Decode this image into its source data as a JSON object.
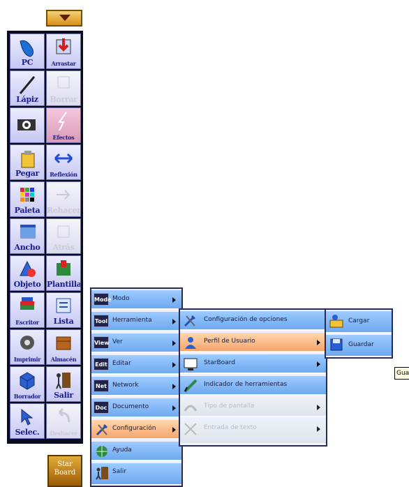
{
  "toolbar": {
    "tools": [
      {
        "label": "PC",
        "icon": "mouse-icon"
      },
      {
        "label": "Arrastar",
        "icon": "drag-icon"
      },
      {
        "label": "Lápiz",
        "icon": "pencil-icon"
      },
      {
        "label": "Borrar",
        "icon": "eraser-icon"
      },
      {
        "label": "",
        "icon": "camera-icon"
      },
      {
        "label": "Efectos",
        "icon": "effects-icon"
      },
      {
        "label": "Pegar",
        "icon": "paste-icon"
      },
      {
        "label": "Reflexión",
        "icon": "reflect-icon"
      },
      {
        "label": "Paleta",
        "icon": "palette-icon"
      },
      {
        "label": "Rehacer",
        "icon": "redo-icon"
      },
      {
        "label": "Ancho",
        "icon": "width-icon"
      },
      {
        "label": "Atrás",
        "icon": "back-icon"
      },
      {
        "label": "Objeto",
        "icon": "shapes-icon"
      },
      {
        "label": "Plantilla",
        "icon": "template-icon"
      },
      {
        "label": "Escritor",
        "icon": "writer-icon"
      },
      {
        "label": "Lista",
        "icon": "list-icon"
      },
      {
        "label": "Imprimir",
        "icon": "printer-icon"
      },
      {
        "label": "Almacén",
        "icon": "storage-icon"
      },
      {
        "label": "Borrador",
        "icon": "cube-eraser-icon"
      },
      {
        "label": "Salir",
        "icon": "exit-icon"
      },
      {
        "label": "Selec.",
        "icon": "select-arrow-icon"
      },
      {
        "label": "Deshacer",
        "icon": "undo-icon"
      }
    ],
    "start_label_line1": "Star",
    "start_label_line2": "Board"
  },
  "menu_main": {
    "items": [
      {
        "badge": "Mode",
        "label": "Modo"
      },
      {
        "badge": "Tool",
        "label": "Herramienta"
      },
      {
        "badge": "View",
        "label": "Ver"
      },
      {
        "badge": "Edit",
        "label": "Editar"
      },
      {
        "badge": "Net",
        "label": "Network"
      },
      {
        "badge": "Doc",
        "label": "Documento"
      },
      {
        "badge": "",
        "label": "Configuración"
      },
      {
        "badge": "",
        "label": "Ayuda"
      },
      {
        "badge": "",
        "label": "Salir"
      }
    ]
  },
  "menu_config": {
    "items": [
      {
        "label": "Configuración de opciones"
      },
      {
        "label": "Perfil de Usuario"
      },
      {
        "label": "StarBoard"
      },
      {
        "label": "Indicador de herramientas"
      },
      {
        "label": "Tipo de pantalla"
      },
      {
        "label": "Entrada de texto"
      }
    ]
  },
  "menu_profile": {
    "items": [
      {
        "label": "Cargar"
      },
      {
        "label": "Guardar"
      }
    ]
  },
  "tooltip": "Guardar"
}
